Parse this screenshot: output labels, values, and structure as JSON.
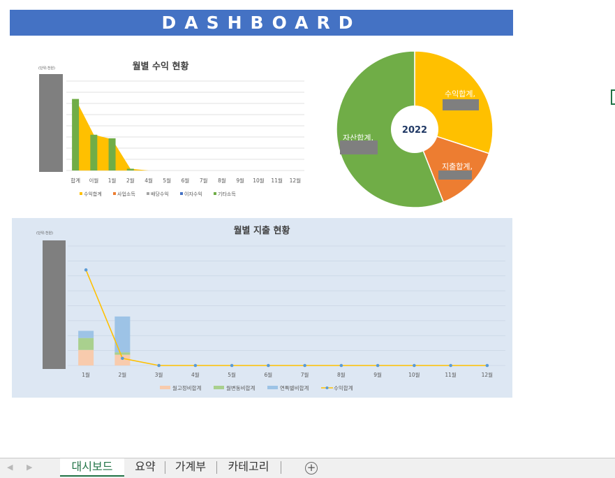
{
  "dashboard": {
    "title": "DASHBOARD"
  },
  "colors": {
    "banner": "#4472c4",
    "income": "#ffc000",
    "business": "#ed7d31",
    "dividend": "#a5a5a5",
    "interest": "#4472c4",
    "other": "#70ad47",
    "fixed": "#f8cbad",
    "variable": "#a9d08e",
    "annual": "#9dc3e6",
    "line": "#ffc000"
  },
  "income_chart": {
    "title": "월별 수익 현황",
    "unit": "(단위:천원)",
    "categories": [
      "합계",
      "이월",
      "1월",
      "2월",
      "4월",
      "5월",
      "6월",
      "7월",
      "8월",
      "9월",
      "10월",
      "11월",
      "12월"
    ],
    "legend": [
      "수익합계",
      "사업소득",
      "배당수익",
      "이자수익",
      "기타소득"
    ]
  },
  "donut": {
    "center_label": "2022",
    "labels": {
      "income": "수익합계,",
      "expense": "지출합계,",
      "asset": "자산합계,"
    }
  },
  "expense_chart": {
    "title": "월별 지출 현황",
    "unit": "(단위:천원)",
    "categories": [
      "1월",
      "2월",
      "3월",
      "4월",
      "5월",
      "6월",
      "7월",
      "8월",
      "9월",
      "10월",
      "11월",
      "12월"
    ],
    "legend": [
      "월고정비합계",
      "월변동비합계",
      "연특별비합계",
      "수익합계"
    ]
  },
  "chart_data": [
    {
      "type": "bar",
      "title": "월별 수익 현황",
      "categories": [
        "합계",
        "이월",
        "1월",
        "2월",
        "4월",
        "5월",
        "6월",
        "7월",
        "8월",
        "9월",
        "10월",
        "11월",
        "12월"
      ],
      "series": [
        {
          "name": "수익합계",
          "values": [
            0.8,
            0.4,
            0.35,
            0.02,
            0,
            0,
            0,
            0,
            0,
            0,
            0,
            0,
            0
          ]
        },
        {
          "name": "기타소득",
          "values": [
            0.8,
            0.4,
            0.36,
            0.02,
            0,
            0,
            0,
            0,
            0,
            0,
            0,
            0,
            0
          ]
        }
      ],
      "ylim": [
        0,
        1
      ]
    },
    {
      "type": "pie",
      "title": "2022",
      "categories": [
        "수익합계",
        "지출합계",
        "자산합계"
      ],
      "values": [
        30,
        14,
        56
      ]
    },
    {
      "type": "bar",
      "title": "월별 지출 현황",
      "categories": [
        "1월",
        "2월",
        "3월",
        "4월",
        "5월",
        "6월",
        "7월",
        "8월",
        "9월",
        "10월",
        "11월",
        "12월"
      ],
      "series": [
        {
          "name": "월고정비합계",
          "values": [
            0.13,
            0.09,
            0,
            0,
            0,
            0,
            0,
            0,
            0,
            0,
            0,
            0
          ]
        },
        {
          "name": "월변동비합계",
          "values": [
            0.1,
            0.02,
            0,
            0,
            0,
            0,
            0,
            0,
            0,
            0,
            0,
            0
          ]
        },
        {
          "name": "연특별비합계",
          "values": [
            0.06,
            0.3,
            0,
            0,
            0,
            0,
            0,
            0,
            0,
            0,
            0,
            0
          ]
        },
        {
          "name": "수익합계",
          "values": [
            0.8,
            0.06,
            0,
            0,
            0,
            0,
            0,
            0,
            0,
            0,
            0,
            0
          ]
        }
      ],
      "ylim": [
        0,
        1
      ]
    }
  ],
  "sheet_tabs": [
    "대시보드",
    "요약",
    "가계부",
    "카테고리"
  ],
  "icons": {
    "prev": "chevron-left-icon",
    "next": "chevron-right-icon",
    "add": "plus-circle-icon"
  }
}
